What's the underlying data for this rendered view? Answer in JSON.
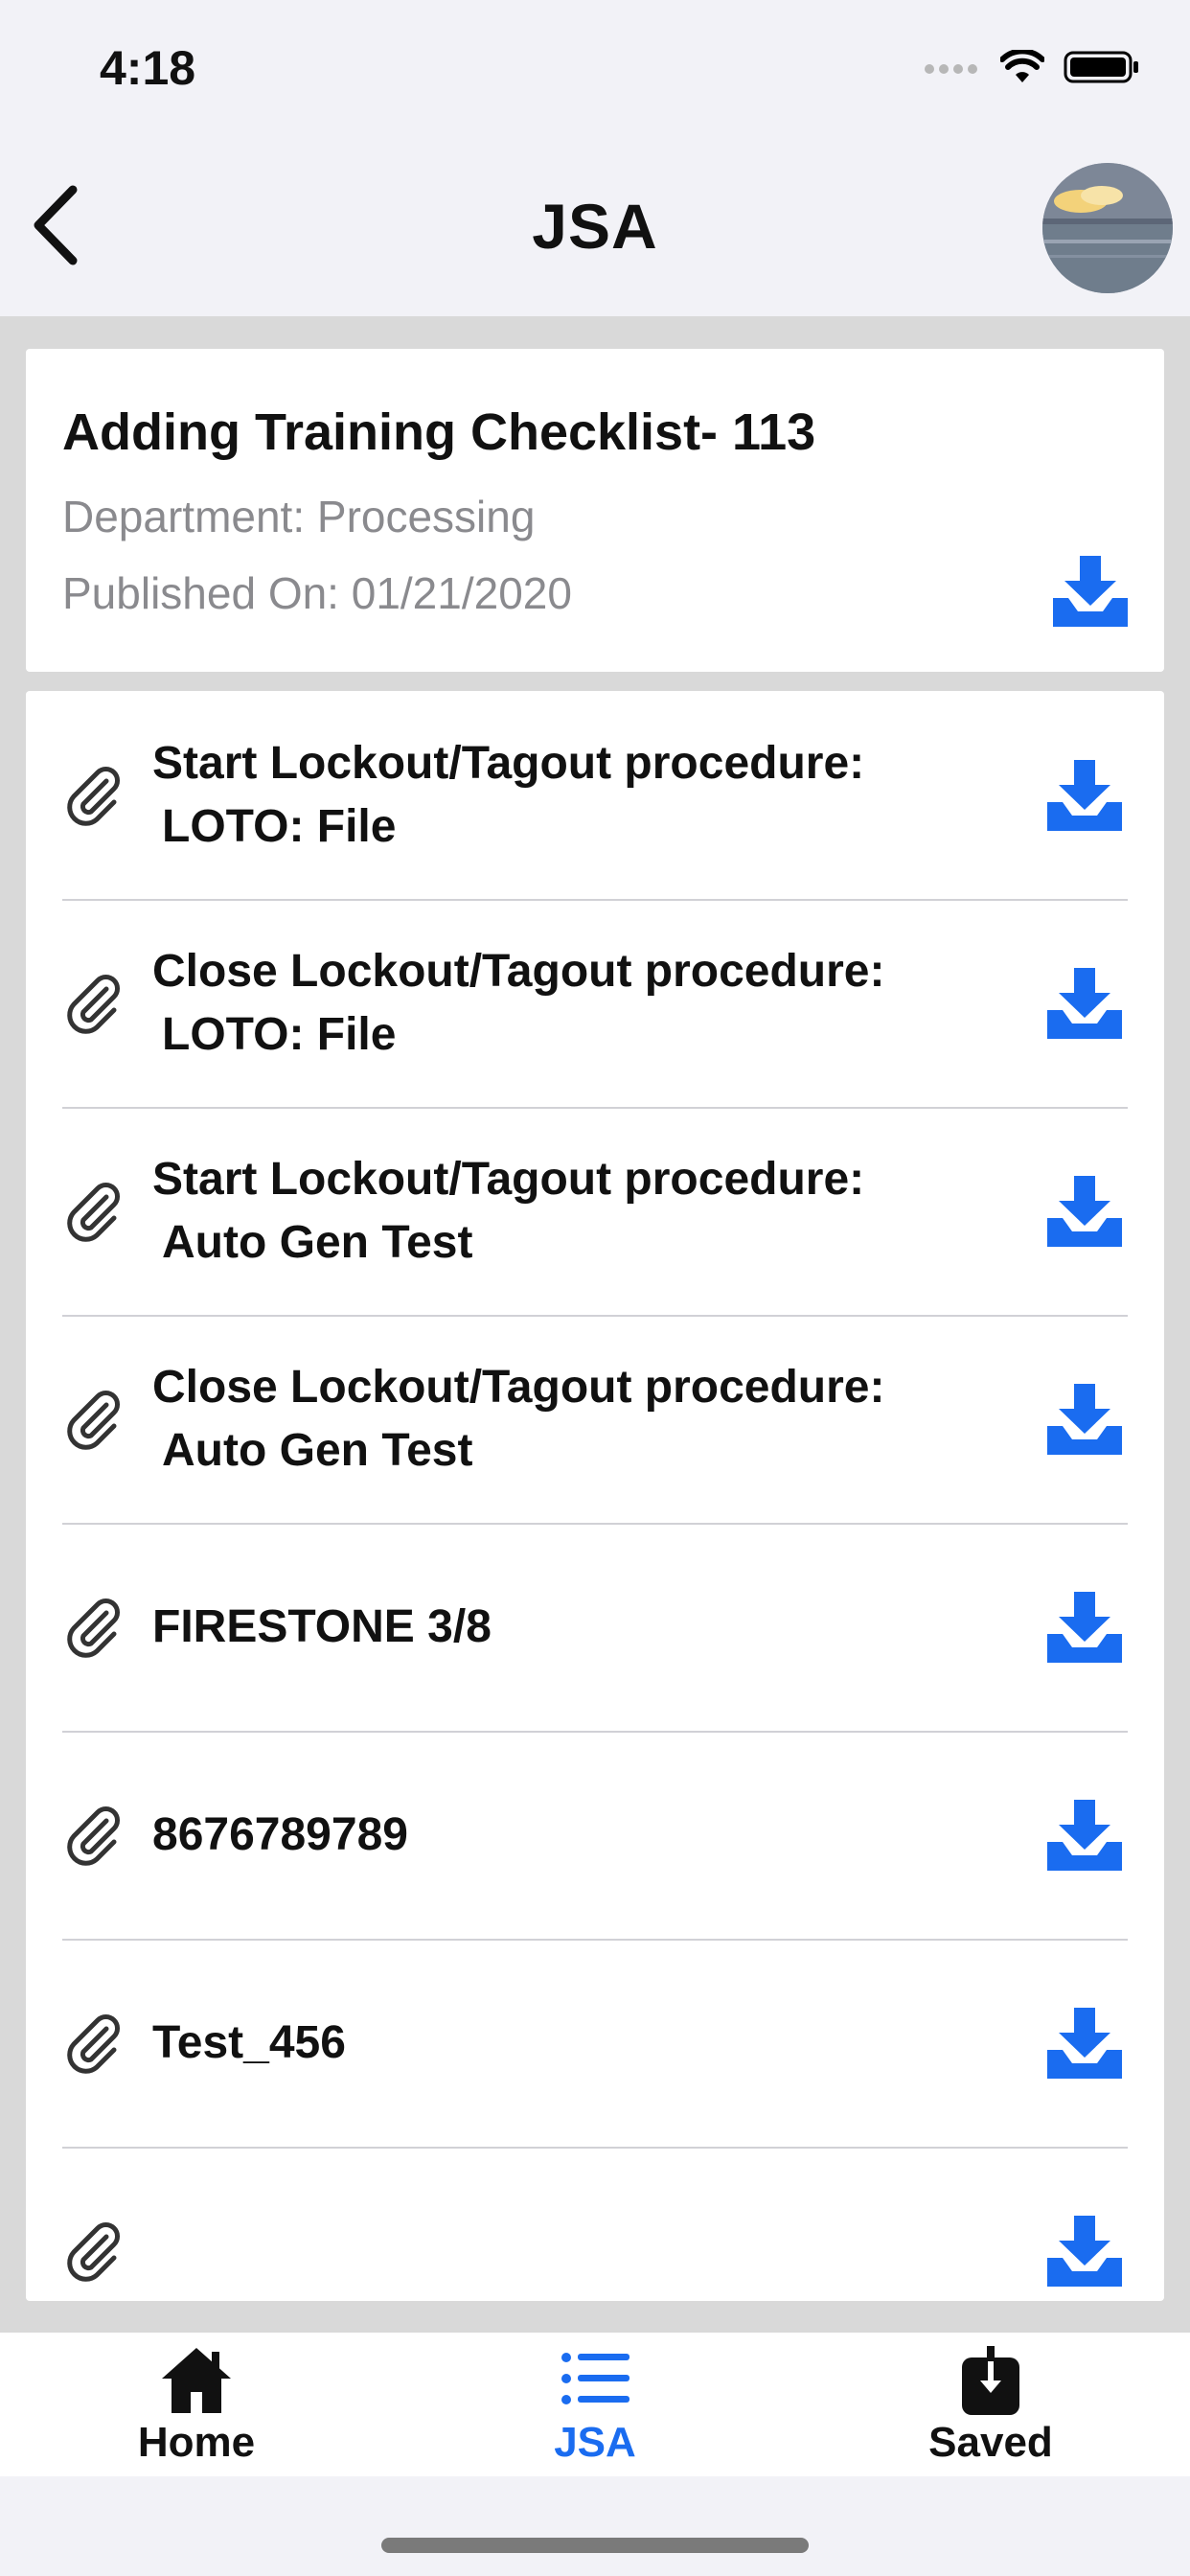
{
  "status": {
    "time": "4:18"
  },
  "nav": {
    "title": "JSA"
  },
  "document": {
    "title": "Adding Training Checklist- 113",
    "department": "Department:  Processing",
    "published": "Published On: 01/21/2020"
  },
  "attachments": [
    {
      "line1": "Start Lockout/Tagout procedure:",
      "line2": "LOTO: File"
    },
    {
      "line1": "Close Lockout/Tagout procedure:",
      "line2": "LOTO: File"
    },
    {
      "line1": "Start Lockout/Tagout procedure:",
      "line2": "Auto Gen Test"
    },
    {
      "line1": "Close Lockout/Tagout procedure:",
      "line2": "Auto Gen Test"
    },
    {
      "line1": "FIRESTONE 3/8",
      "line2": ""
    },
    {
      "line1": "8676789789",
      "line2": ""
    },
    {
      "line1": "Test_456",
      "line2": ""
    },
    {
      "line1": "",
      "line2": ""
    }
  ],
  "tabs": {
    "home": "Home",
    "jsa": "JSA",
    "saved": "Saved"
  },
  "icons": {
    "back": "chevron-left-icon",
    "avatar": "avatar",
    "download": "download-icon",
    "attachment": "paperclip-icon",
    "home": "home-icon",
    "list": "list-icon",
    "saved": "saved-download-icon"
  },
  "colors": {
    "accent": "#1a6cf0",
    "background": "#f2f2f7",
    "content": "#d9d9d9",
    "meta": "#8a8a8e"
  }
}
